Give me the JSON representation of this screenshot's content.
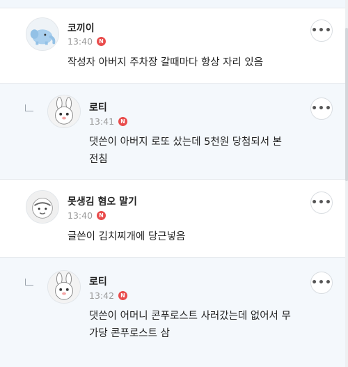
{
  "comments": [
    {
      "author": "코끼이",
      "time": "13:40",
      "badge": "N",
      "text": "작성자 아버지 주차장 갈때마다 항상 자리 있음",
      "avatar": "elephant-avatar",
      "reply": false,
      "more": "•••"
    },
    {
      "author": "로티",
      "time": "13:41",
      "badge": "N",
      "text": "댓쓴이 아버지 로또 샀는데 5천원 당첨되서 본\n전침",
      "avatar": "rabbit-avatar",
      "reply": true,
      "more": "•••"
    },
    {
      "author": "못생김 혐오 말기",
      "time": "13:40",
      "badge": "N",
      "text": "글쓴이 김치찌개에 당근넣음",
      "avatar": "hamster-avatar",
      "reply": false,
      "more": "•••"
    },
    {
      "author": "로티",
      "time": "13:42",
      "badge": "N",
      "text": "댓쓴이 어머니 콘푸로스트 사러갔는데 없어서 무\n가당 콘푸로스트 삼",
      "avatar": "rabbit-avatar",
      "reply": true,
      "more": "•••"
    }
  ],
  "colors": {
    "reply_bg": "#f4f8fc",
    "badge": "#e94c4c",
    "time": "#9a9a9a"
  }
}
